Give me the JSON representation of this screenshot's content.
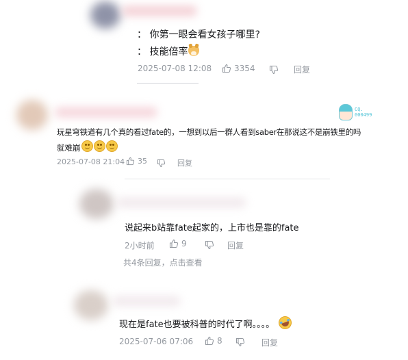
{
  "comment1": {
    "lines": [
      "： 你第一眼会看女孩子哪里?",
      "： 技能倍率"
    ],
    "time": "2025-07-08 12:08",
    "likes": "3354",
    "reply_label": "回复"
  },
  "comment2": {
    "text_line1": "玩星穹铁道有几个真的看过fate的，一想到以后一群人看到saber在那说这不是崩铁里的吗",
    "text_line2": "就难崩",
    "time": "2025-07-08 21:04",
    "likes": "35",
    "reply_label": "回复",
    "badge_text": "CQ.\n000499"
  },
  "reply1": {
    "text": "说起来b站靠fate起家的，上市也是靠的fate",
    "time": "2小时前",
    "likes": "9",
    "reply_label": "回复",
    "more_replies": "共4条回复，点击查看"
  },
  "reply2": {
    "text": "现在是fate也要被科普的时代了啊。。。。",
    "time": "2025-07-06 07:06",
    "likes": "8",
    "reply_label": "回复"
  },
  "colors": {
    "meta_gray": "#9499a0",
    "text": "#18191c",
    "divider": "#e3e5e7"
  }
}
